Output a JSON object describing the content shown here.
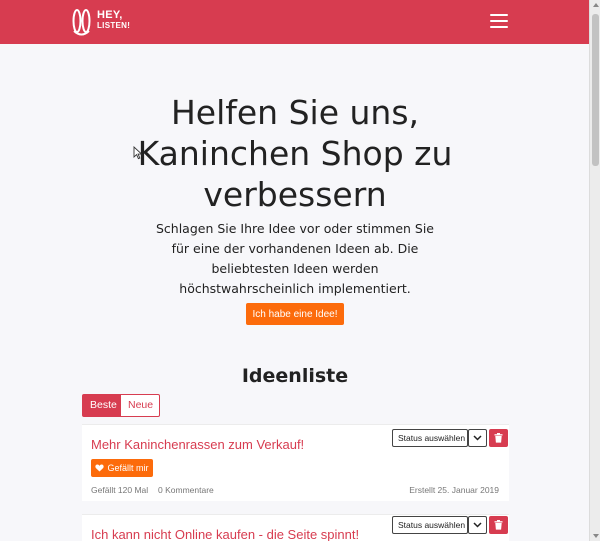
{
  "brand": {
    "logo_line1": "HEY,",
    "logo_line2": "LISTEN!"
  },
  "hero": {
    "title": "Helfen Sie uns, Kaninchen Shop zu verbessern",
    "text": "Schlagen Sie Ihre Idee vor oder stimmen Sie für eine der vorhandenen Ideen ab. Die beliebtesten Ideen werden höchstwahrscheinlich implementiert.",
    "cta_label": "Ich habe eine Idee!"
  },
  "ideas_section": {
    "title": "Ideenliste",
    "tabs": [
      {
        "label": "Beste",
        "active": true
      },
      {
        "label": "Neue",
        "active": false
      }
    ]
  },
  "ideas": [
    {
      "title": "Mehr Kaninchenrassen zum Verkauf!",
      "like_label": "Gefällt mir",
      "likes": "Gefällt 120 Mal",
      "comments": "0 Kommentare",
      "created": "Erstellt 25. Januar 2019",
      "status_placeholder": "Status auswählen"
    },
    {
      "title": "Ich kann nicht Online kaufen - die Seite spinnt!",
      "status_placeholder": "Status auswählen"
    }
  ],
  "icons": {
    "menu": "hamburger-menu-icon",
    "like": "heart-icon",
    "delete": "trash-icon",
    "caret": "chevron-down-icon",
    "cursor": "mouse-pointer-icon"
  },
  "colors": {
    "brand": "#d73c50",
    "accent": "#fc6b0b",
    "background": "#f7f7fa"
  }
}
